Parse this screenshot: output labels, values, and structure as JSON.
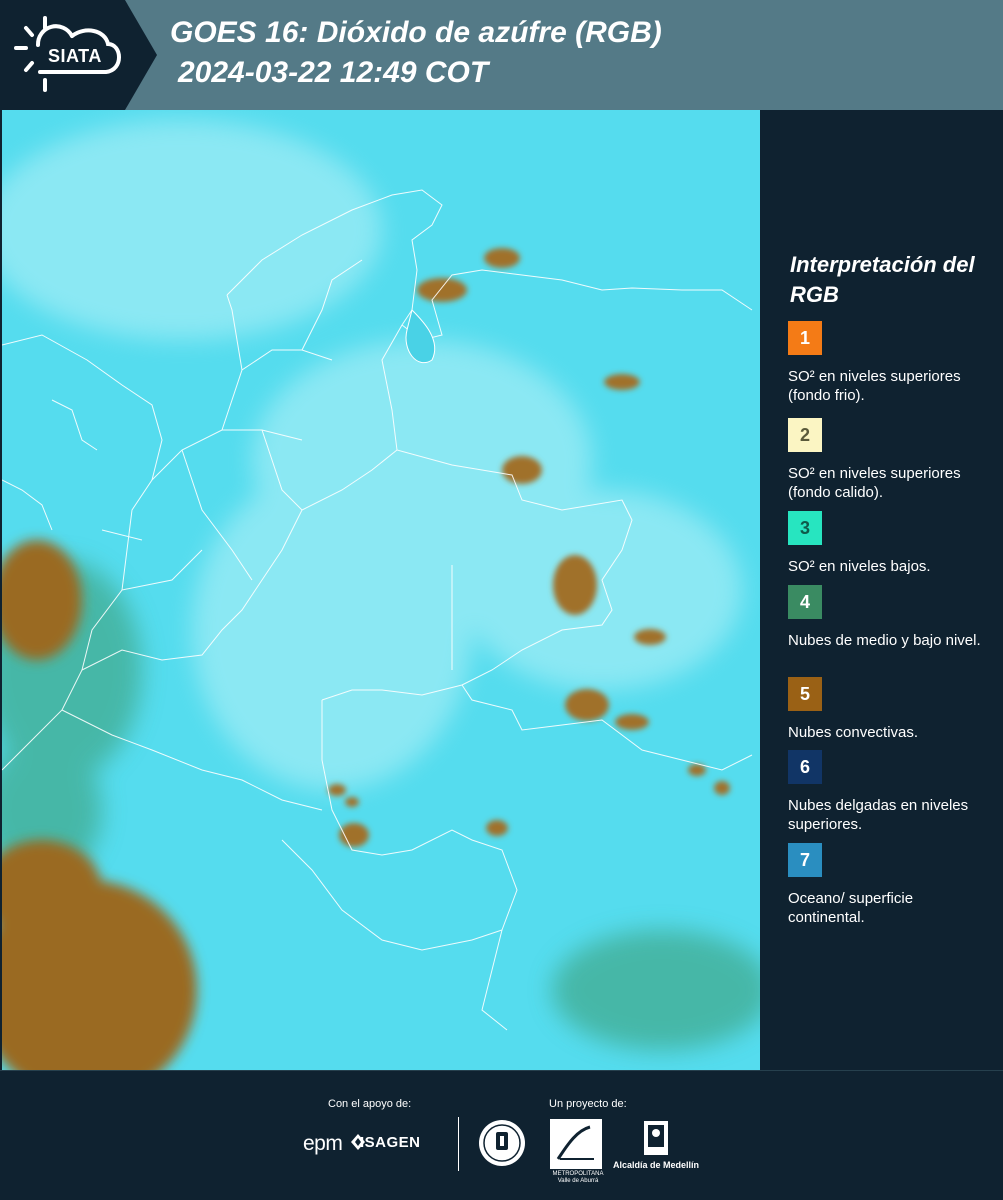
{
  "header": {
    "logo_text": "SIATA",
    "title": "GOES 16: Dióxido de azúfre (RGB)",
    "datetime": "2024-03-22 12:49 COT",
    "background": "#547a87"
  },
  "legend": {
    "title": "Interpretación del RGB",
    "items": [
      {
        "number": "1",
        "text": "SO² en niveles superiores (fondo frio).",
        "color": "#f47b16"
      },
      {
        "number": "2",
        "text": "SO² en niveles superiores (fondo calido).",
        "color": "#fbf5c3"
      },
      {
        "number": "3",
        "text": "SO² en niveles bajos.",
        "color": "#27e5c0"
      },
      {
        "number": "4",
        "text": "Nubes de medio y bajo nivel.",
        "color": "#3a8b62"
      },
      {
        "number": "5",
        "text": "Nubes convectivas.",
        "color": "#9a6115"
      },
      {
        "number": "6",
        "text": "Nubes delgadas en niveles superiores.",
        "color": "#113566"
      },
      {
        "number": "7",
        "text": "Oceano/ superficie continental.",
        "color": "#2a8ec0"
      }
    ]
  },
  "map": {
    "background": "#55dcee",
    "cloud_color": "#9a6a22"
  },
  "footer": {
    "support_label": "Con el apoyo de:",
    "project_label": "Un proyecto de:",
    "sponsor_1": "epm",
    "sponsor_2": "ISAGEN",
    "partner_area": "METROPOLITANA Valle de Aburrá",
    "partner_alcaldia": "Alcaldía de Medellín"
  }
}
